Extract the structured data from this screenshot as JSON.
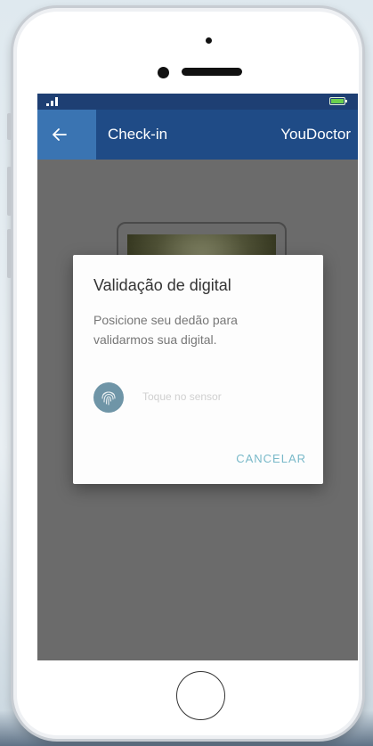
{
  "app_bar": {
    "title": "Check-in",
    "brand": "YouDoctor",
    "back_icon": "arrow-left-icon",
    "color_primary": "#1f4b86",
    "color_back": "#3a74b2"
  },
  "dialog": {
    "title": "Validação de digital",
    "message": "Posicione seu dedão para validarmos sua digital.",
    "sensor_hint": "Toque no sensor",
    "fingerprint_icon": "fingerprint-icon",
    "cancel_label": "CANCELAR",
    "accent_color": "#79b9c9"
  }
}
